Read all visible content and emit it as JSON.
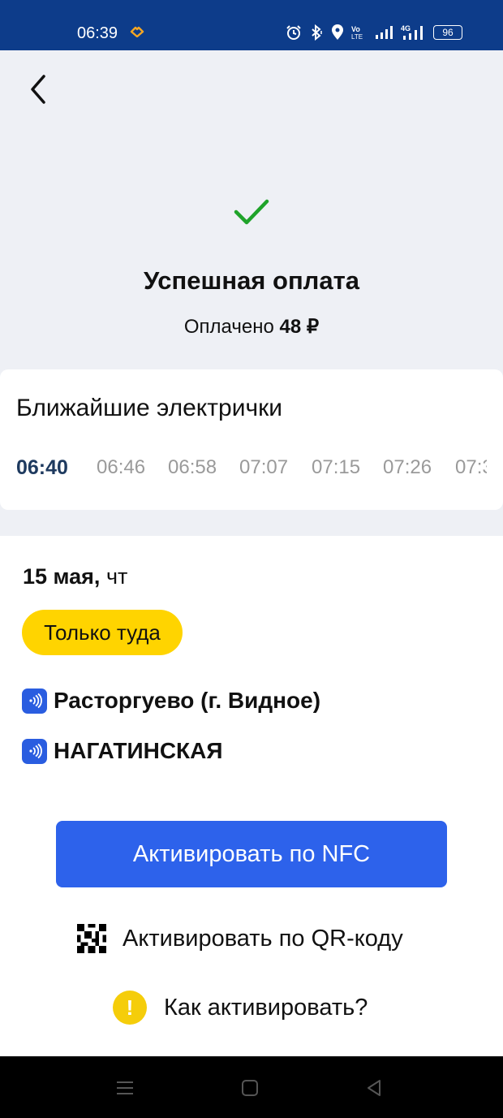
{
  "status_bar": {
    "time": "06:39",
    "battery": "96",
    "network": "4G",
    "volte": "Vo LTE"
  },
  "payment": {
    "title": "Успешная оплата",
    "paid_label": "Оплачено",
    "amount": "48 ₽"
  },
  "trains": {
    "title": "Ближайшие электрички",
    "times": [
      "06:40",
      "06:46",
      "06:58",
      "07:07",
      "07:15",
      "07:26",
      "07:3"
    ],
    "selected_index": 0
  },
  "ticket": {
    "date": "15 мая,",
    "weekday": " чт",
    "direction": "Только туда",
    "from": "Расторгуево (г. Видное)",
    "to": "НАГАТИНСКАЯ"
  },
  "actions": {
    "nfc": "Активировать по NFC",
    "qr": "Активировать по QR-коду",
    "howto": "Как активировать?"
  },
  "colors": {
    "status_bar": "#0d3c8a",
    "primary": "#2d62eb",
    "badge": "#ffd400",
    "success": "#1fa32a"
  },
  "icons": {
    "back": "chevron-left-icon",
    "success": "check-icon",
    "station": "nfc-icon",
    "qr": "qr-code-icon",
    "help": "exclamation-icon"
  }
}
